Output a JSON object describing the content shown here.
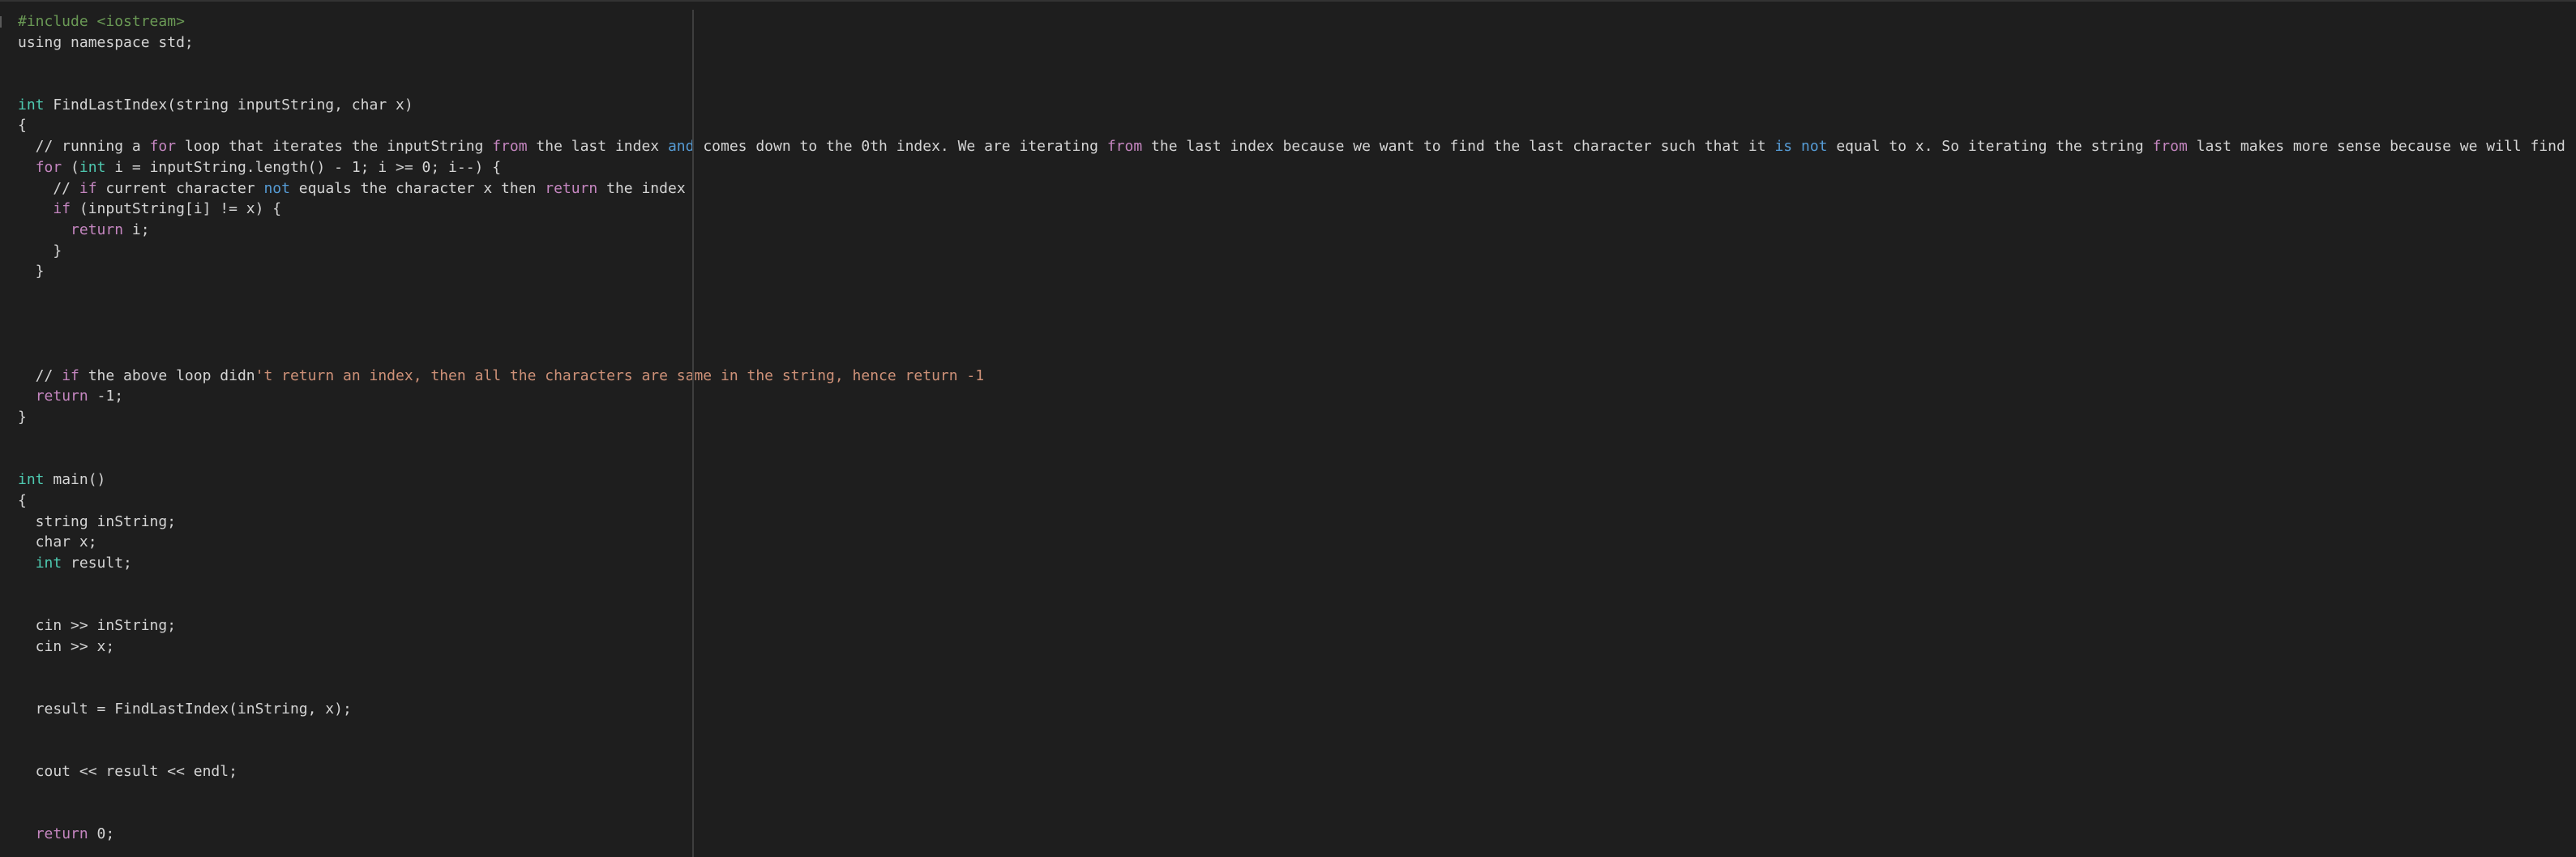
{
  "editor": {
    "language": "cpp",
    "colors": {
      "background": "#1e1e1e",
      "text": "#d4d4d4",
      "keyword": "#569cd6",
      "control": "#c586c0",
      "type": "#4ec9b0",
      "string": "#ce9178",
      "preprocessor": "#6a9955",
      "number": "#b5cea8",
      "ruler": "#3e3e3e"
    },
    "lines": [
      [
        {
          "t": "#include <iostream>",
          "c": "pp"
        }
      ],
      [
        {
          "t": "using namespace std;",
          "c": ""
        }
      ],
      [],
      [],
      [
        {
          "t": "int",
          "c": "typ"
        },
        {
          "t": " FindLastIndex(string inputString, char x)",
          "c": ""
        }
      ],
      [
        {
          "t": "{",
          "c": ""
        }
      ],
      [
        {
          "t": "  // running a ",
          "c": ""
        },
        {
          "t": "for",
          "c": "ctl"
        },
        {
          "t": " loop that iterates the inputString ",
          "c": ""
        },
        {
          "t": "from",
          "c": "ctl"
        },
        {
          "t": " the last index ",
          "c": ""
        },
        {
          "t": "and",
          "c": "kw"
        },
        {
          "t": " comes down to the 0th index. We are iterating ",
          "c": ""
        },
        {
          "t": "from",
          "c": "ctl"
        },
        {
          "t": " the last index because we want to find the last character such that it ",
          "c": ""
        },
        {
          "t": "is",
          "c": "kw"
        },
        {
          "t": " ",
          "c": ""
        },
        {
          "t": "not",
          "c": "kw"
        },
        {
          "t": " equal to x. So iterating the string ",
          "c": ""
        },
        {
          "t": "from",
          "c": "ctl"
        },
        {
          "t": " last makes more sense because we will find the value fas",
          "c": ""
        }
      ],
      [
        {
          "t": "  ",
          "c": ""
        },
        {
          "t": "for",
          "c": "ctl"
        },
        {
          "t": " (",
          "c": ""
        },
        {
          "t": "int",
          "c": "typ"
        },
        {
          "t": " i = inputString.length() - 1; i >= 0; i--) {",
          "c": ""
        }
      ],
      [
        {
          "t": "    // ",
          "c": ""
        },
        {
          "t": "if",
          "c": "ctl"
        },
        {
          "t": " current character ",
          "c": ""
        },
        {
          "t": "not",
          "c": "kw"
        },
        {
          "t": " equals the character x then ",
          "c": ""
        },
        {
          "t": "return",
          "c": "ctl"
        },
        {
          "t": " the index",
          "c": ""
        }
      ],
      [
        {
          "t": "    ",
          "c": ""
        },
        {
          "t": "if",
          "c": "ctl"
        },
        {
          "t": " (inputString[i] != x) {",
          "c": ""
        }
      ],
      [
        {
          "t": "      ",
          "c": ""
        },
        {
          "t": "return",
          "c": "ctl"
        },
        {
          "t": " i;",
          "c": ""
        }
      ],
      [
        {
          "t": "    }",
          "c": ""
        }
      ],
      [
        {
          "t": "  }",
          "c": ""
        }
      ],
      [],
      [],
      [],
      [],
      [
        {
          "t": "  // ",
          "c": ""
        },
        {
          "t": "if",
          "c": "ctl"
        },
        {
          "t": " the above loop didn",
          "c": ""
        },
        {
          "t": "'t return an index, then all the characters are same in the string, hence return -1",
          "c": "str"
        }
      ],
      [
        {
          "t": "  ",
          "c": ""
        },
        {
          "t": "return",
          "c": "ctl"
        },
        {
          "t": " -1;",
          "c": ""
        }
      ],
      [
        {
          "t": "}",
          "c": ""
        }
      ],
      [],
      [],
      [
        {
          "t": "int",
          "c": "typ"
        },
        {
          "t": " main()",
          "c": ""
        }
      ],
      [
        {
          "t": "{",
          "c": ""
        }
      ],
      [
        {
          "t": "  string inString;",
          "c": ""
        }
      ],
      [
        {
          "t": "  char x;",
          "c": ""
        }
      ],
      [
        {
          "t": "  ",
          "c": ""
        },
        {
          "t": "int",
          "c": "typ"
        },
        {
          "t": " result;",
          "c": ""
        }
      ],
      [],
      [],
      [
        {
          "t": "  cin >> inString;",
          "c": ""
        }
      ],
      [
        {
          "t": "  cin >> x;",
          "c": ""
        }
      ],
      [],
      [],
      [
        {
          "t": "  result = FindLastIndex(inString, x);",
          "c": ""
        }
      ],
      [],
      [],
      [
        {
          "t": "  cout << result << endl;",
          "c": ""
        }
      ],
      [],
      [],
      [
        {
          "t": "  ",
          "c": ""
        },
        {
          "t": "return",
          "c": "ctl"
        },
        {
          "t": " 0;",
          "c": ""
        }
      ]
    ]
  }
}
